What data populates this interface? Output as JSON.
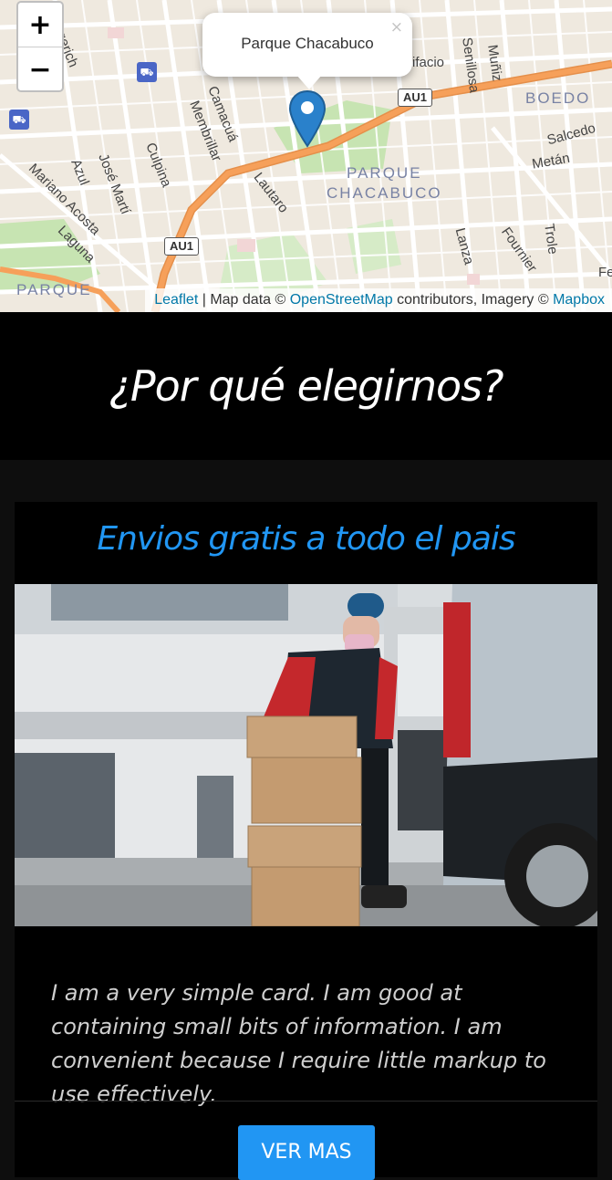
{
  "map": {
    "zoom_in": "+",
    "zoom_out": "−",
    "popup_text": "Parque Chacabuco",
    "popup_close": "×",
    "attribution": {
      "leaflet": "Leaflet",
      "sep": " | Map data © ",
      "osm": "OpenStreetMap",
      "middle": " contributors, Imagery © ",
      "mapbox": "Mapbox"
    },
    "streets": [
      "Argerich",
      "Camacuá",
      "Membrillar",
      "Culpina",
      "Lautaro",
      "Azul",
      "José Martí",
      "Mariano Acosta",
      "Laguna",
      "Senillosa",
      "Muñiz",
      "Salcedo",
      "Metán",
      "Lanza",
      "Fournier",
      "Trole",
      "ifacio",
      "Fe"
    ],
    "districts": [
      "BOEDO",
      "PARQUE",
      "CHACABUCO",
      "PARQUE"
    ],
    "highway_label": "AU1",
    "colors": {
      "highway": "#f6a05a",
      "park": "#c7e4b2",
      "marker": "#2a81cb"
    }
  },
  "section": {
    "heading": "¿Por qué elegirnos?"
  },
  "card": {
    "title": "Envios gratis a todo el pais",
    "text": "I am a very simple card. I am good at containing small bits of information. I am convenient because I require little markup to use effectively.",
    "button": "VER MAS"
  },
  "colors": {
    "accent": "#2196f3",
    "band": "#000000",
    "page": "#0e0e0e"
  }
}
